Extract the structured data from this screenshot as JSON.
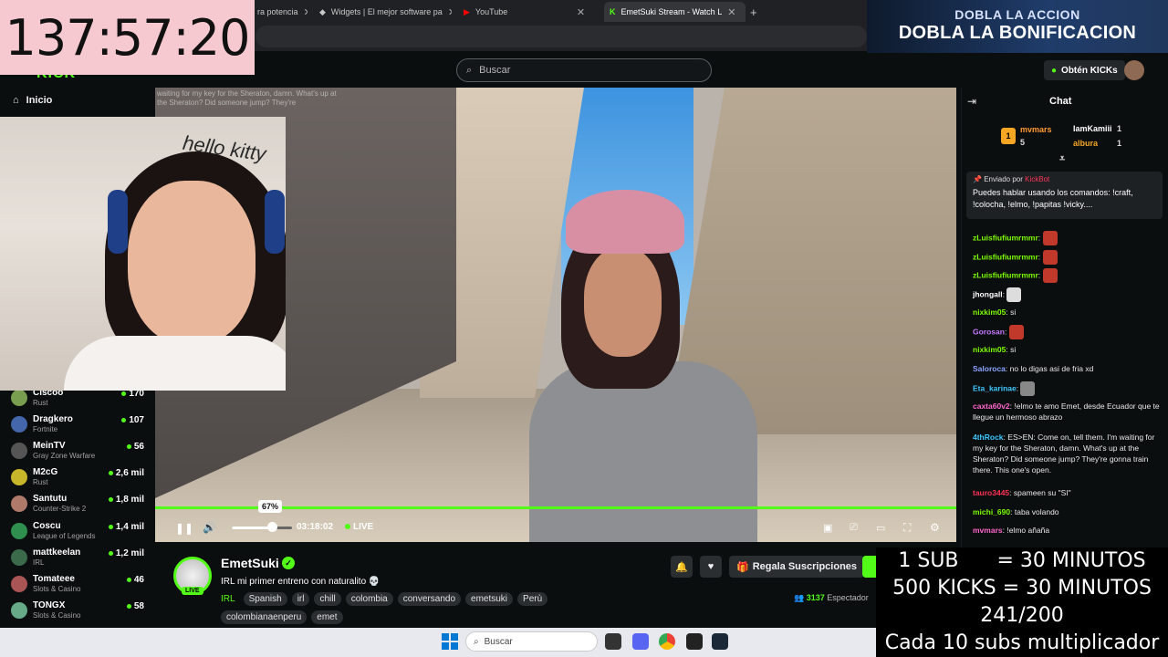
{
  "timer": "137:57:20",
  "promo": {
    "line1": "DOBLA LA ACCION",
    "line2": "DOBLA LA BONIFICACION"
  },
  "tabs": [
    {
      "label": "ra potencia",
      "active": false
    },
    {
      "label": "Widgets | El mejor software pa",
      "active": false
    },
    {
      "label": "YouTube",
      "active": false
    },
    {
      "label": "EmetSuki Stream - Watch L",
      "active": true
    }
  ],
  "header": {
    "search_placeholder": "Buscar",
    "obten_kicks": "Obtén KICKs"
  },
  "sidebar": {
    "home": "Inicio",
    "channels": [
      {
        "name": "Ciscoo",
        "game": "Rust",
        "viewers": "170",
        "color": "#7a9e4f"
      },
      {
        "name": "Dragkero",
        "game": "Fortnite",
        "viewers": "107",
        "color": "#4466aa"
      },
      {
        "name": "MeinTV",
        "game": "Gray Zone Warfare",
        "viewers": "56",
        "color": "#555"
      },
      {
        "name": "M2cG",
        "game": "Rust",
        "viewers": "2,6 mil",
        "color": "#c8b62a"
      },
      {
        "name": "Santutu",
        "game": "Counter-Strike 2",
        "viewers": "1,8 mil",
        "color": "#b07a6a"
      },
      {
        "name": "Coscu",
        "game": "League of Legends",
        "viewers": "1,4 mil",
        "color": "#2f8f4f"
      },
      {
        "name": "mattkeelan",
        "game": "IRL",
        "viewers": "1,2 mil",
        "color": "#3a6a4a"
      },
      {
        "name": "Tomateee",
        "game": "Slots & Casino",
        "viewers": "46",
        "color": "#a55"
      },
      {
        "name": "TONGX",
        "game": "Slots & Casino",
        "viewers": "58",
        "color": "#6a8"
      }
    ]
  },
  "video_overlay_text": "waiting for my key for the Sheraton, damn. What's up at the Sheraton? Did someone jump? They're",
  "player": {
    "volume_tip": "67%",
    "volume": 0.67,
    "time": "03:18:02",
    "live": "LIVE"
  },
  "channel": {
    "name": "EmetSuki",
    "live_badge": "LIVE",
    "title": "IRL mi primer entreno con naturalito 💀",
    "category": "IRL",
    "tags": [
      "Spanish",
      "irl",
      "chill",
      "colombia",
      "conversando",
      "emetsuki",
      "Perù",
      "colombianaenperu",
      "emet"
    ],
    "gift_label": "Regala Suscripciones",
    "viewers_count": "3137",
    "viewers_label": "Espectador"
  },
  "subathon": {
    "line1": "1 SUB      = 30 MINUTOS",
    "line2": "500 KICKS = 30 MINUTOS",
    "line3": "241/200",
    "line4": "Cada 10 subs multiplicador"
  },
  "chat": {
    "title": "Chat",
    "leaders": [
      {
        "name": "mvmars",
        "count": "5",
        "color": "#ff9933"
      },
      {
        "name": "IamKamiii",
        "count": "1",
        "color": "#ffffff"
      },
      {
        "name": "albura",
        "count": "1",
        "color": "#f5a623"
      }
    ],
    "pinned_by": "Enviado por",
    "pinned_user": "KickBot",
    "pinned_msg": "Puedes hablar usando los comandos: !craft, !colocha, !elmo, !papitas !vicky....",
    "messages": [
      {
        "user": "zLuisfiufiumrmmr",
        "text": "",
        "color": "#7cfc00",
        "emote": "#c0392b"
      },
      {
        "user": "zLuisfiufiumrmmr",
        "text": "",
        "color": "#7cfc00",
        "emote": "#c0392b"
      },
      {
        "user": "zLuisfiufiumrmmr",
        "text": "",
        "color": "#7cfc00",
        "emote": "#c0392b"
      },
      {
        "user": "jhongall",
        "text": "",
        "color": "#ffffff",
        "emote": "#dddddd"
      },
      {
        "user": "nixkim05",
        "text": "si",
        "color": "#7cfc00",
        "emote": ""
      },
      {
        "user": "Gorosan",
        "text": "",
        "color": "#c678ff",
        "emote": "#c0392b"
      },
      {
        "user": "nixkim05",
        "text": "si",
        "color": "#7cfc00",
        "emote": ""
      },
      {
        "user": "Saloroca",
        "text": "no lo digas asi de fria xd",
        "color": "#8aa4ff",
        "emote": ""
      },
      {
        "user": "Eta_karinae",
        "text": "",
        "color": "#3ec8ff",
        "emote": "#888888"
      },
      {
        "user": "caxta60v2",
        "text": "!elmo te amo Emet, desde Ecuador que te llegue un hermoso abrazo",
        "color": "#ff66cc",
        "emote": ""
      },
      {
        "user": "4thRock",
        "text": "ES>EN: Come on, tell them. I'm waiting for my key for the Sheraton, damn. What's up at the Sheraton? Did someone jump? They're gonna train there. This one's open.",
        "color": "#3ec8ff",
        "emote": ""
      },
      {
        "user": "tauro3445",
        "text": "spameen su \"SI\"",
        "color": "#ff3355",
        "emote": ""
      },
      {
        "user": "michi_690",
        "text": "taba volando",
        "color": "#7cfc00",
        "emote": ""
      },
      {
        "user": "mvmars",
        "text": "!elmo añaña",
        "color": "#ff66cc",
        "emote": ""
      }
    ]
  },
  "taskbar": {
    "search": "Buscar"
  }
}
